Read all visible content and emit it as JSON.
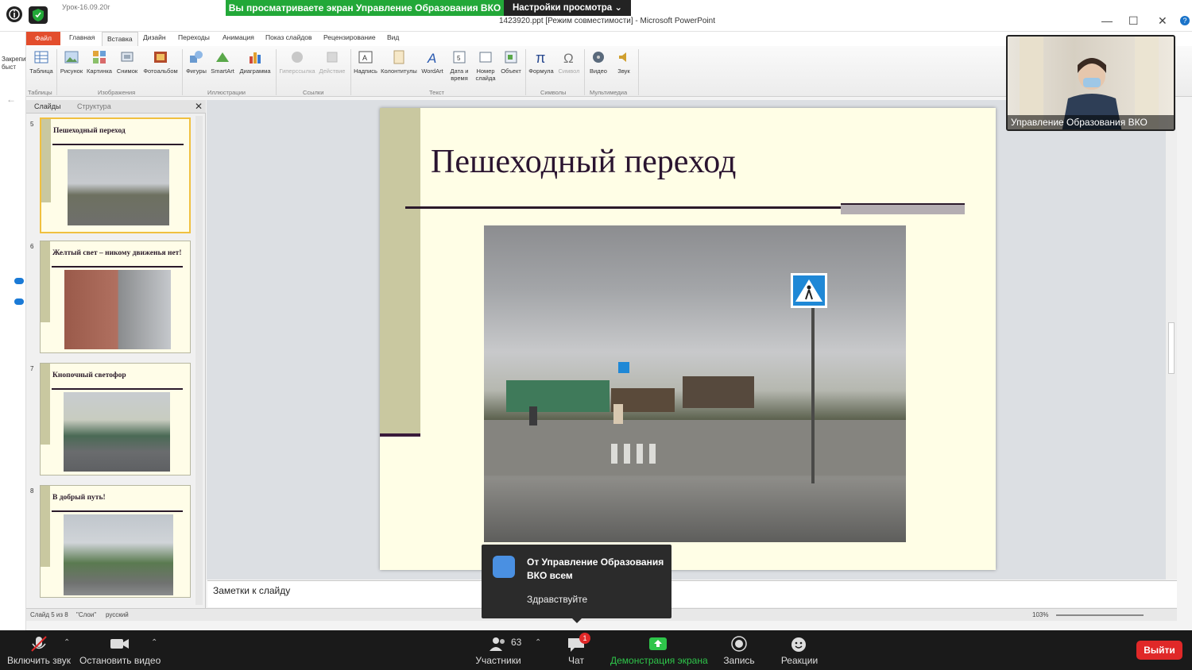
{
  "titlebar": {
    "lesson_title": "Урок-16.09.20г",
    "screen_banner": "Вы просматриваете экран Управление Образования ВКО",
    "view_settings": "Настройки просмотра",
    "doc_title": "1423920.ppt [Режим совместимости] - Microsoft PowerPoint"
  },
  "left_strip": {
    "label": "Закрепить быст"
  },
  "ribbon": {
    "tabs": [
      "Файл",
      "Главная",
      "Вставка",
      "Дизайн",
      "Переходы",
      "Анимация",
      "Показ слайдов",
      "Рецензирование",
      "Вид"
    ],
    "buttons": [
      "Таблица",
      "Рисунок",
      "Картинка",
      "Снимок",
      "Фотоальбом",
      "Фигуры",
      "SmartArt",
      "Диаграмма",
      "Гиперссылка",
      "Действие",
      "Надпись",
      "Колонтитулы",
      "WordArt",
      "Дата и время",
      "Номер слайда",
      "Объект",
      "Формула",
      "Символ",
      "Видео",
      "Звук"
    ],
    "groups": [
      "Таблицы",
      "Изображения",
      "Иллюстрации",
      "Ссылки",
      "Текст",
      "Символы",
      "Мультимедиа"
    ]
  },
  "slide_panel": {
    "tabs": [
      "Слайды",
      "Структура"
    ],
    "slides": [
      {
        "num": "5",
        "title": "Пешеходный переход"
      },
      {
        "num": "6",
        "title": "Желтый свет – никому движенья нет!"
      },
      {
        "num": "7",
        "title": "Кнопочный светофор"
      },
      {
        "num": "8",
        "title": "В  добрый путь!"
      }
    ]
  },
  "slide": {
    "title": "Пешеходный переход"
  },
  "notes": {
    "placeholder": "Заметки к слайду"
  },
  "status": {
    "slide_info": "Слайд 5 из 8",
    "theme": "\"Слои\"",
    "language": "русский",
    "zoom": "103%"
  },
  "webcam": {
    "name": "Управление Образования ВКО"
  },
  "chat_popup": {
    "from": "От Управление Образования ВКО всем",
    "message": "Здравствуйте"
  },
  "zoom_bar": {
    "unmute": "Включить звук",
    "start_video": "Остановить видео",
    "participants": "Участники",
    "participants_count": "63",
    "chat": "Чат",
    "chat_badge": "1",
    "share": "Демонстрация экрана",
    "record": "Запись",
    "reactions": "Реакции",
    "leave": "Выйти"
  }
}
